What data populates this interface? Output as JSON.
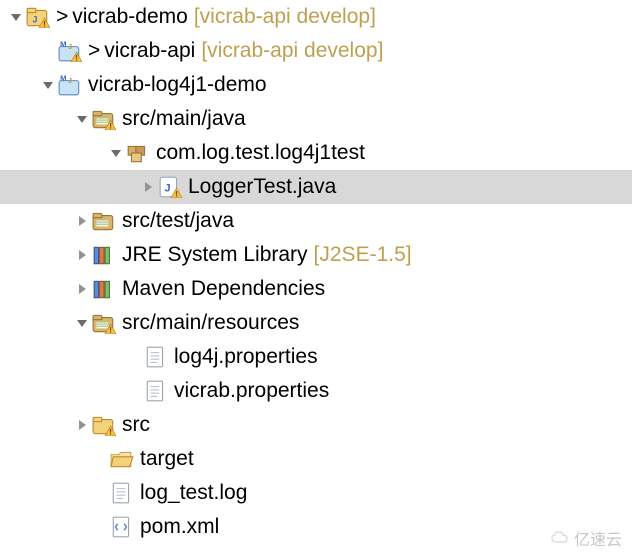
{
  "nodes": [
    {
      "indent": 8,
      "arrow": "down",
      "icon": "project-warn",
      "vcs": ">",
      "label": "vicrab-demo",
      "branch": "[vicrab-api develop]",
      "selected": false
    },
    {
      "indent": 40,
      "arrow": "none",
      "icon": "maven-warn",
      "vcs": ">",
      "label": "vicrab-api",
      "branch": "[vicrab-api develop]",
      "selected": false
    },
    {
      "indent": 40,
      "arrow": "down",
      "icon": "maven-module",
      "vcs": "",
      "label": "vicrab-log4j1-demo",
      "branch": "",
      "selected": false
    },
    {
      "indent": 74,
      "arrow": "down",
      "icon": "source-folder-warn",
      "vcs": "",
      "label": "src/main/java",
      "branch": "",
      "selected": false
    },
    {
      "indent": 108,
      "arrow": "down",
      "icon": "package",
      "vcs": "",
      "label": "com.log.test.log4j1test",
      "branch": "",
      "selected": false
    },
    {
      "indent": 140,
      "arrow": "right",
      "icon": "java-warn",
      "vcs": "",
      "label": "LoggerTest.java",
      "branch": "",
      "selected": true
    },
    {
      "indent": 74,
      "arrow": "right",
      "icon": "source-folder",
      "vcs": "",
      "label": "src/test/java",
      "branch": "",
      "selected": false
    },
    {
      "indent": 74,
      "arrow": "right",
      "icon": "library",
      "vcs": "",
      "label": "JRE System Library",
      "branch": "[J2SE-1.5]",
      "selected": false
    },
    {
      "indent": 74,
      "arrow": "right",
      "icon": "library",
      "vcs": "",
      "label": "Maven Dependencies",
      "branch": "",
      "selected": false
    },
    {
      "indent": 74,
      "arrow": "down",
      "icon": "source-folder-warn",
      "vcs": "",
      "label": "src/main/resources",
      "branch": "",
      "selected": false
    },
    {
      "indent": 126,
      "arrow": "none",
      "icon": "file",
      "vcs": "",
      "label": "log4j.properties",
      "branch": "",
      "selected": false
    },
    {
      "indent": 126,
      "arrow": "none",
      "icon": "file",
      "vcs": "",
      "label": "vicrab.properties",
      "branch": "",
      "selected": false
    },
    {
      "indent": 74,
      "arrow": "right",
      "icon": "folder-warn",
      "vcs": "",
      "label": "src",
      "branch": "",
      "selected": false
    },
    {
      "indent": 92,
      "arrow": "none",
      "icon": "folder-open",
      "vcs": "",
      "label": "target",
      "branch": "",
      "selected": false
    },
    {
      "indent": 92,
      "arrow": "none",
      "icon": "file",
      "vcs": "",
      "label": "log_test.log",
      "branch": "",
      "selected": false
    },
    {
      "indent": 92,
      "arrow": "none",
      "icon": "xml",
      "vcs": "",
      "label": "pom.xml",
      "branch": "",
      "selected": false
    }
  ],
  "watermark": "亿速云"
}
